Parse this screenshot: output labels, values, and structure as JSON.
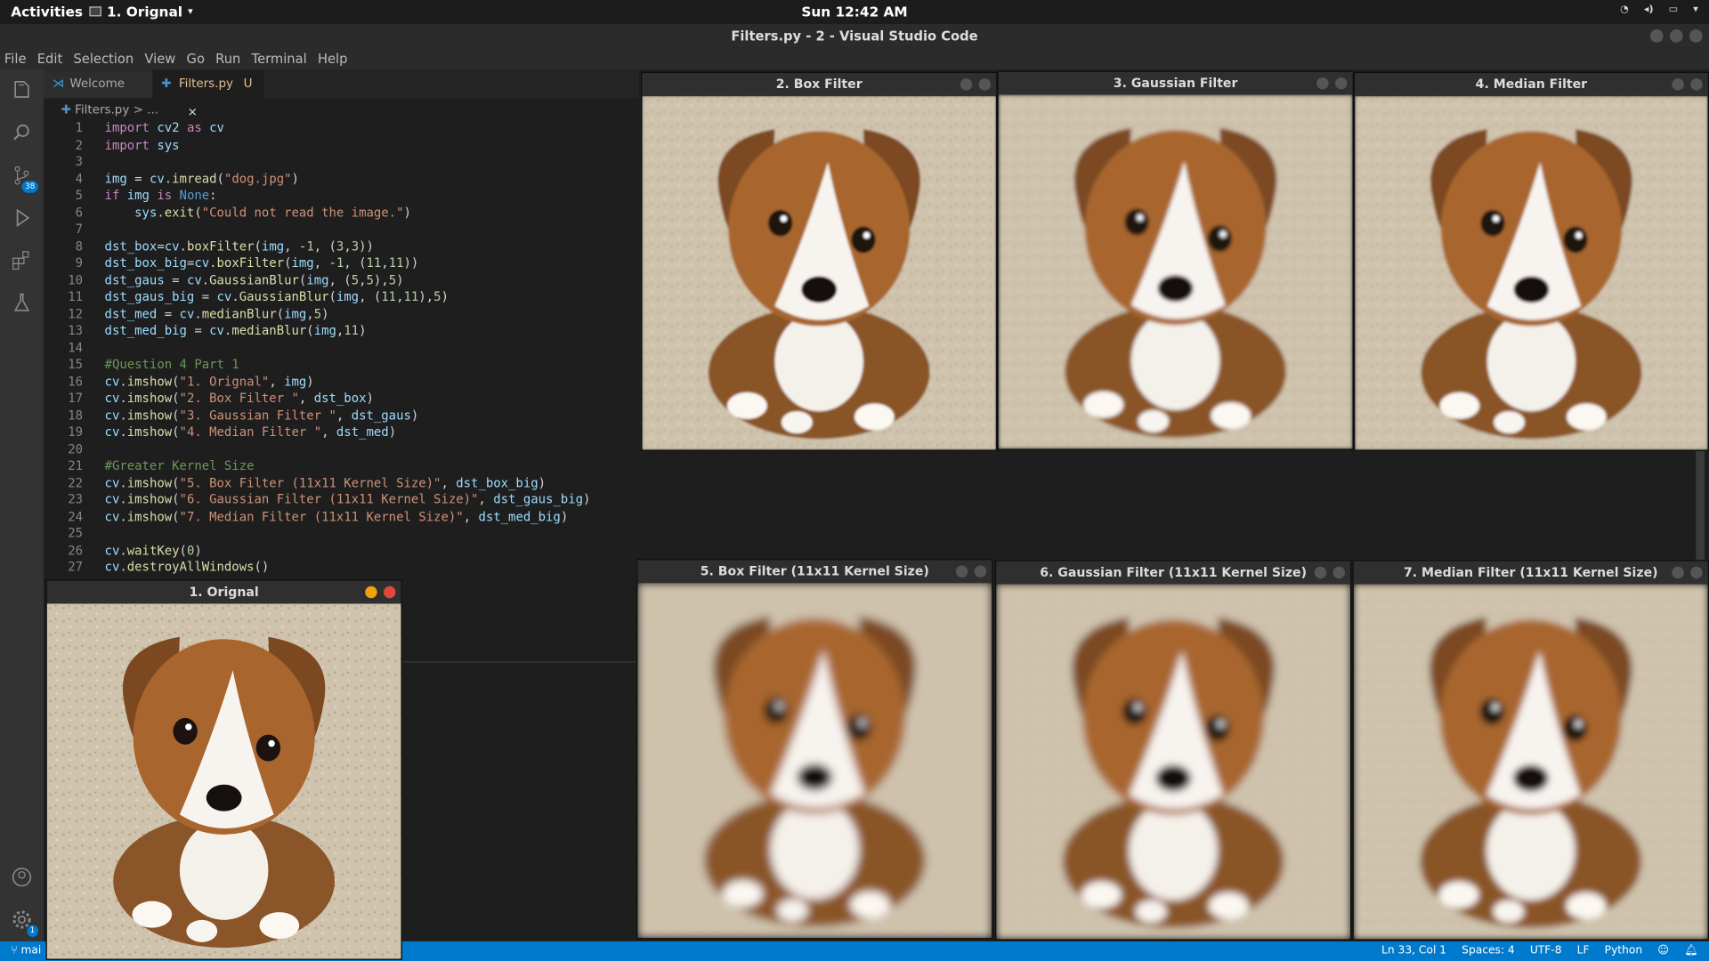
{
  "topbar": {
    "activities": "Activities",
    "app_name": "1. Orignal",
    "clock": "Sun 12:42 AM"
  },
  "window": {
    "title": "Filters.py - 2 - Visual Studio Code"
  },
  "menu": [
    "File",
    "Edit",
    "Selection",
    "View",
    "Go",
    "Run",
    "Terminal",
    "Help"
  ],
  "activity_bar": {
    "scm_badge": "38",
    "settings_badge": "1"
  },
  "tabs": [
    {
      "label": "Welcome"
    },
    {
      "label": "Filters.py",
      "status": "U",
      "close": "×"
    }
  ],
  "breadcrumb": {
    "file": "Filters.py",
    "sep": ">",
    "more": "..."
  },
  "code_lines": [
    "import cv2 as cv",
    "import sys",
    "",
    "img = cv.imread(\"dog.jpg\")",
    "if img is None:",
    "    sys.exit(\"Could not read the image.\")",
    "",
    "dst_box=cv.boxFilter(img, -1, (3,3))",
    "dst_box_big=cv.boxFilter(img, -1, (11,11))",
    "dst_gaus = cv.GaussianBlur(img, (5,5),5)",
    "dst_gaus_big = cv.GaussianBlur(img, (11,11),5)",
    "dst_med = cv.medianBlur(img,5)",
    "dst_med_big = cv.medianBlur(img,11)",
    "",
    "#Question 4 Part 1",
    "cv.imshow(\"1. Orignal\", img)",
    "cv.imshow(\"2. Box Filter \", dst_box)",
    "cv.imshow(\"3. Gaussian Filter \", dst_gaus)",
    "cv.imshow(\"4. Median Filter \", dst_med)",
    "",
    "#Greater Kernel Size",
    "cv.imshow(\"5. Box Filter (11x11 Kernel Size)\", dst_box_big)",
    "cv.imshow(\"6. Gaussian Filter (11x11 Kernel Size)\", dst_gaus_big)",
    "cv.imshow(\"7. Median Filter (11x11 Kernel Size)\", dst_med_big)",
    "",
    "cv.waitKey(0)",
    "cv.destroyAllWindows()"
  ],
  "image_windows": [
    {
      "title": "2. Box Filter",
      "blur": 1
    },
    {
      "title": "3. Gaussian Filter",
      "blur": 1.8
    },
    {
      "title": "4. Median Filter",
      "blur": 1.2
    },
    {
      "title": "5. Box Filter (11x11 Kernel Size)",
      "blur": 4
    },
    {
      "title": "6. Gaussian Filter (11x11 Kernel Size)",
      "blur": 3.5
    },
    {
      "title": "7. Median Filter (11x11 Kernel Size)",
      "blur": 3
    },
    {
      "title": "1. Orignal",
      "blur": 0
    }
  ],
  "statusbar": {
    "branch": "mai",
    "position": "Ln 33, Col 1",
    "spaces": "Spaces: 4",
    "encoding": "UTF-8",
    "eol": "LF",
    "language": "Python"
  },
  "colors": {
    "accent": "#007acc",
    "editor_bg": "#1e1e1e"
  }
}
